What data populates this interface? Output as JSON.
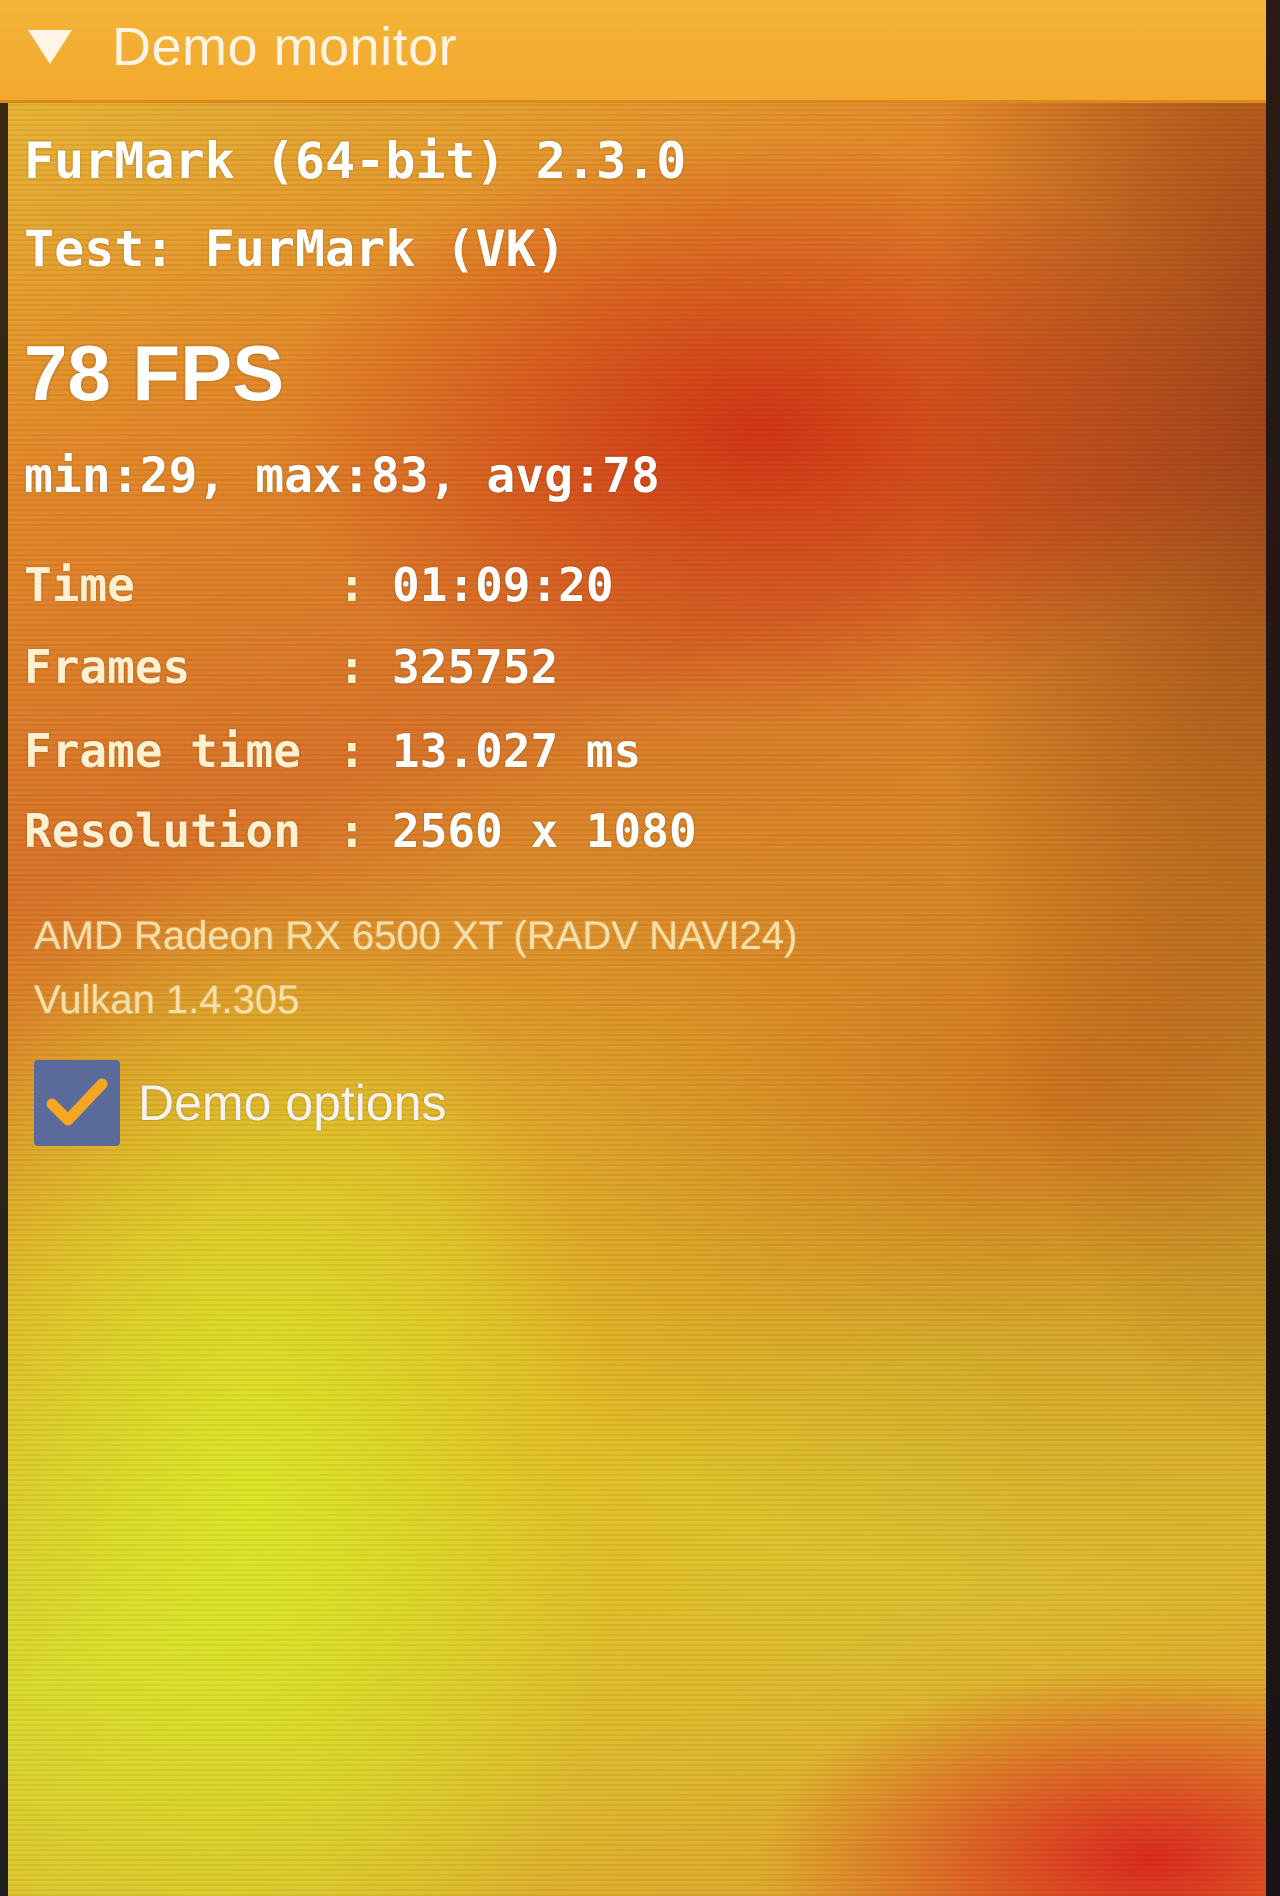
{
  "window": {
    "title": "Demo monitor",
    "collapse_icon": "triangle-down-icon",
    "accent_color": "#f2ab30"
  },
  "app": {
    "version_line": "FurMark (64-bit) 2.3.0",
    "test_line": "Test: FurMark (VK)"
  },
  "fps": {
    "current": "78 FPS",
    "stats": "min:29, max:83, avg:78"
  },
  "stats": {
    "time": {
      "label": "Time",
      "sep": ":",
      "value": "01:09:20"
    },
    "frames": {
      "label": "Frames",
      "sep": ":",
      "value": "325752"
    },
    "frame_time": {
      "label": "Frame time",
      "sep": ":",
      "value": "13.027 ms"
    },
    "resolution": {
      "label": "Resolution",
      "sep": ":",
      "value": "2560 x 1080"
    }
  },
  "gpu": {
    "name": "AMD Radeon RX 6500 XT (RADV NAVI24)",
    "api": "Vulkan 1.4.305"
  },
  "options": {
    "label": "Demo options",
    "checked": true,
    "checkbox_color": "#5a6a9a",
    "check_color": "#f5a623"
  }
}
